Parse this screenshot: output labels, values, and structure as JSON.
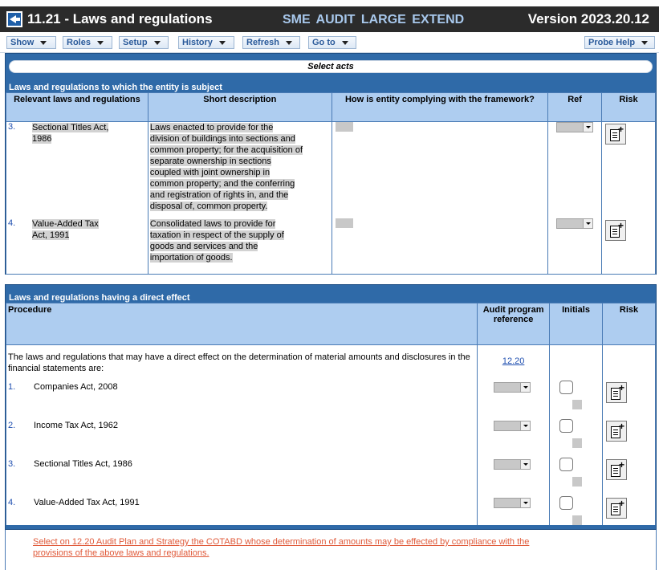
{
  "header": {
    "title": "11.21 - Laws and regulations",
    "package": "SME  AUDIT  LARGE  EXTEND",
    "version": "Version 2023.20.12"
  },
  "menu": {
    "show": "Show",
    "roles": "Roles",
    "setup": "Setup",
    "history": "History",
    "refresh": "Refresh",
    "goto": "Go to",
    "probe_help": "Probe Help"
  },
  "select_acts_label": "Select acts",
  "section1": {
    "title": "Laws and regulations to which the entity is subject",
    "columns": {
      "relevant": "Relevant laws and regulations",
      "short": "Short description",
      "complying": "How is entity complying with the framework?",
      "ref": "Ref",
      "risk": "Risk"
    },
    "rows": [
      {
        "num": "3.",
        "law": "Sectional Titles Act, 1986",
        "desc": "Laws enacted to provide for the division of buildings into sections and common property; for the acquisition of separate ownership in sections coupled with joint ownership in common property; and the conferring and registration of rights in, and the disposal of, common property."
      },
      {
        "num": "4.",
        "law": "Value-Added Tax Act, 1991",
        "desc": "Consolidated laws to provide for taxation in respect of the supply of goods and services and the importation of goods."
      }
    ]
  },
  "section2": {
    "title": "Laws and regulations having a direct effect",
    "columns": {
      "procedure": "Procedure",
      "audit_ref": "Audit program reference",
      "initials": "Initials",
      "risk": "Risk"
    },
    "intro": "The laws and regulations that may have a direct effect on the determination of material amounts and disclosures in the financial statements are:",
    "intro_ref": "12.20",
    "items": [
      {
        "num": "1.",
        "label": "Companies Act, 2008"
      },
      {
        "num": "2.",
        "label": "Income Tax Act, 1962"
      },
      {
        "num": "3.",
        "label": "Sectional Titles Act, 1986"
      },
      {
        "num": "4.",
        "label": "Value-Added Tax Act, 1991"
      }
    ],
    "footer_note": "Select on 12.20 Audit Plan and Strategy the COTABD whose determination of amounts may be effected by compliance with the provisions of the above laws and regulations."
  }
}
